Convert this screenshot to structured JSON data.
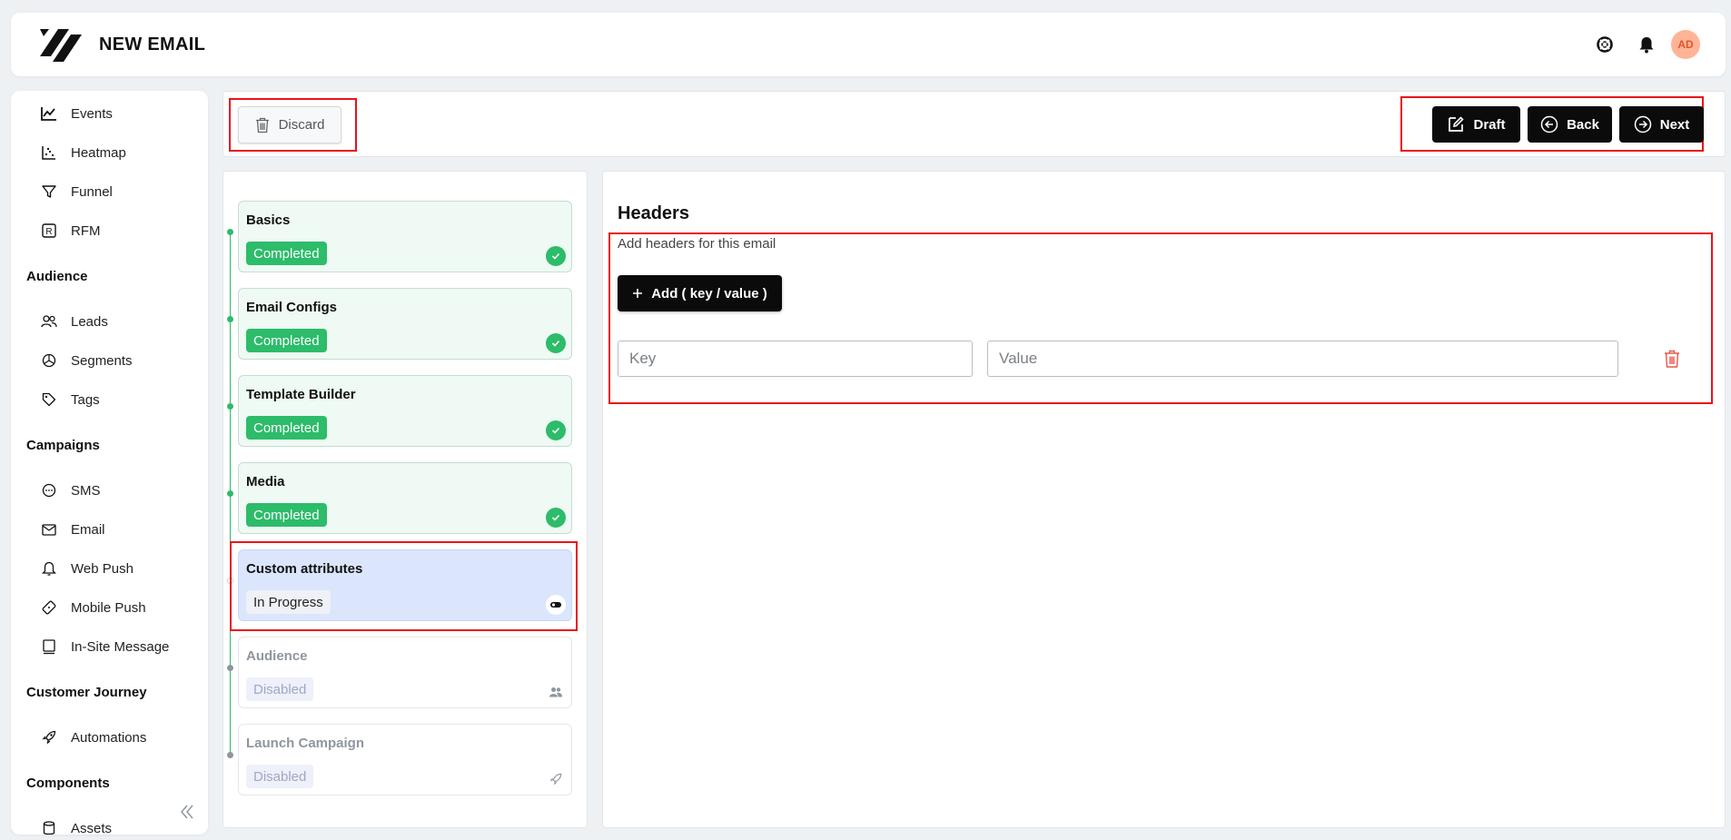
{
  "header": {
    "title": "NEW EMAIL",
    "avatar_initials": "AD",
    "icons": [
      "support-icon",
      "bell-icon"
    ]
  },
  "sidebar": {
    "items_top": [
      {
        "label": "Events",
        "icon": "chart-line-icon"
      },
      {
        "label": "Heatmap",
        "icon": "heatmap-icon"
      },
      {
        "label": "Funnel",
        "icon": "funnel-icon"
      },
      {
        "label": "RFM",
        "icon": "rfm-icon"
      }
    ],
    "sections": [
      {
        "title": "Audience",
        "items": [
          {
            "label": "Leads",
            "icon": "users-icon"
          },
          {
            "label": "Segments",
            "icon": "pie-icon"
          },
          {
            "label": "Tags",
            "icon": "tag-icon"
          }
        ]
      },
      {
        "title": "Campaigns",
        "items": [
          {
            "label": "SMS",
            "icon": "chat-icon"
          },
          {
            "label": "Email",
            "icon": "mail-icon"
          },
          {
            "label": "Web Push",
            "icon": "bell-icon"
          },
          {
            "label": "Mobile Push",
            "icon": "mobile-push-icon"
          },
          {
            "label": "In-Site Message",
            "icon": "message-icon"
          }
        ]
      },
      {
        "title": "Customer Journey",
        "items": [
          {
            "label": "Automations",
            "icon": "rocket-icon"
          }
        ]
      },
      {
        "title": "Components",
        "items": [
          {
            "label": "Assets",
            "icon": "database-icon"
          }
        ]
      }
    ]
  },
  "toolbar": {
    "discard_label": "Discard",
    "draft_label": "Draft",
    "back_label": "Back",
    "next_label": "Next"
  },
  "steps": [
    {
      "title": "Basics",
      "status": "Completed",
      "state": "done"
    },
    {
      "title": "Email Configs",
      "status": "Completed",
      "state": "done"
    },
    {
      "title": "Template Builder",
      "status": "Completed",
      "state": "done"
    },
    {
      "title": "Media",
      "status": "Completed",
      "state": "done"
    },
    {
      "title": "Custom attributes",
      "status": "In Progress",
      "state": "progress"
    },
    {
      "title": "Audience",
      "status": "Disabled",
      "state": "disabled"
    },
    {
      "title": "Launch Campaign",
      "status": "Disabled",
      "state": "disabled"
    }
  ],
  "headers_section": {
    "title": "Headers",
    "subtitle": "Add headers for this email",
    "add_label": "Add ( key / value )",
    "key_placeholder": "Key",
    "value_placeholder": "Value"
  },
  "colors": {
    "accent_dark": "#0b0b0b",
    "success": "#2cbc6a",
    "active_step": "#dbe6fd",
    "highlight_red": "#e8141a",
    "avatar_bg": "#ffb496",
    "delete_red": "#e8554a"
  }
}
